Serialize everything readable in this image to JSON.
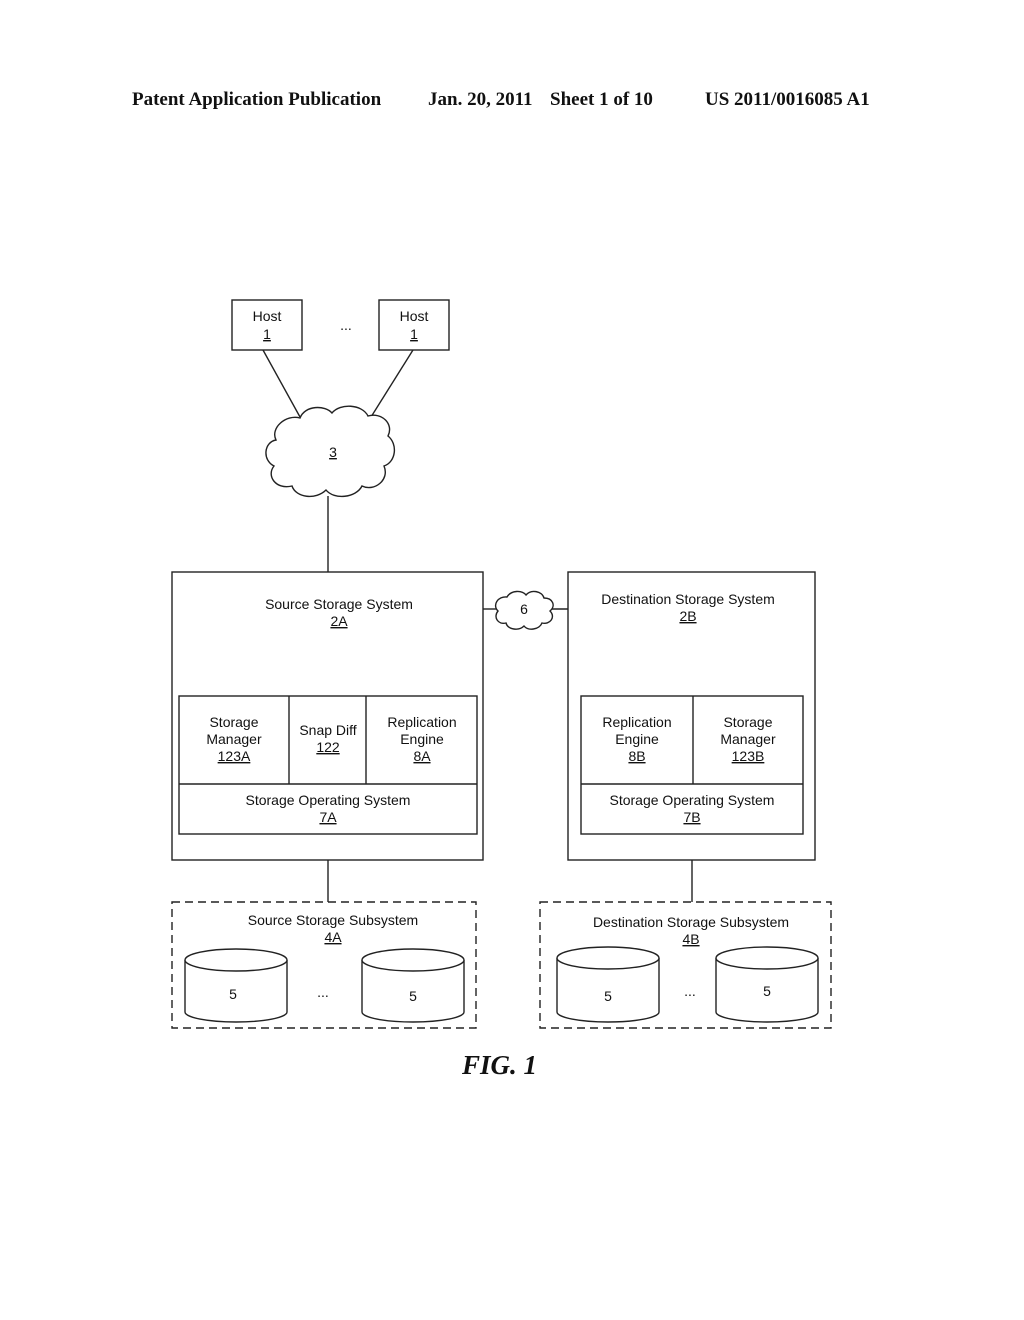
{
  "header": {
    "publication": "Patent Application Publication",
    "date": "Jan. 20, 2011",
    "sheet": "Sheet 1 of 10",
    "number": "US 2011/0016085 A1"
  },
  "hosts": [
    {
      "label": "Host",
      "ref": "1"
    },
    {
      "label": "Host",
      "ref": "1"
    }
  ],
  "ellipsis": "...",
  "network_cloud": {
    "ref": "3"
  },
  "replication_cloud": {
    "label": "6"
  },
  "source_system": {
    "title": "Source Storage System",
    "ref": "2A",
    "modules": [
      {
        "line1": "Storage",
        "line2": "Manager",
        "ref": "123A"
      },
      {
        "line1": "Snap Diff",
        "line2": "",
        "ref": "122"
      },
      {
        "line1": "Replication",
        "line2": "Engine",
        "ref": "8A"
      }
    ],
    "os": {
      "label": "Storage Operating System",
      "ref": "7A"
    }
  },
  "destination_system": {
    "title": "Destination Storage System",
    "ref": "2B",
    "modules": [
      {
        "line1": "Replication",
        "line2": "Engine",
        "ref": "8B"
      },
      {
        "line1": "Storage",
        "line2": "Manager",
        "ref": "123B"
      }
    ],
    "os": {
      "label": "Storage Operating System",
      "ref": "7B"
    }
  },
  "source_subsystem": {
    "title": "Source Storage Subsystem",
    "ref": "4A",
    "disks": [
      "5",
      "5"
    ]
  },
  "destination_subsystem": {
    "title": "Destination Storage Subsystem",
    "ref": "4B",
    "disks": [
      "5",
      "5"
    ]
  },
  "figure_label": "FIG. 1"
}
